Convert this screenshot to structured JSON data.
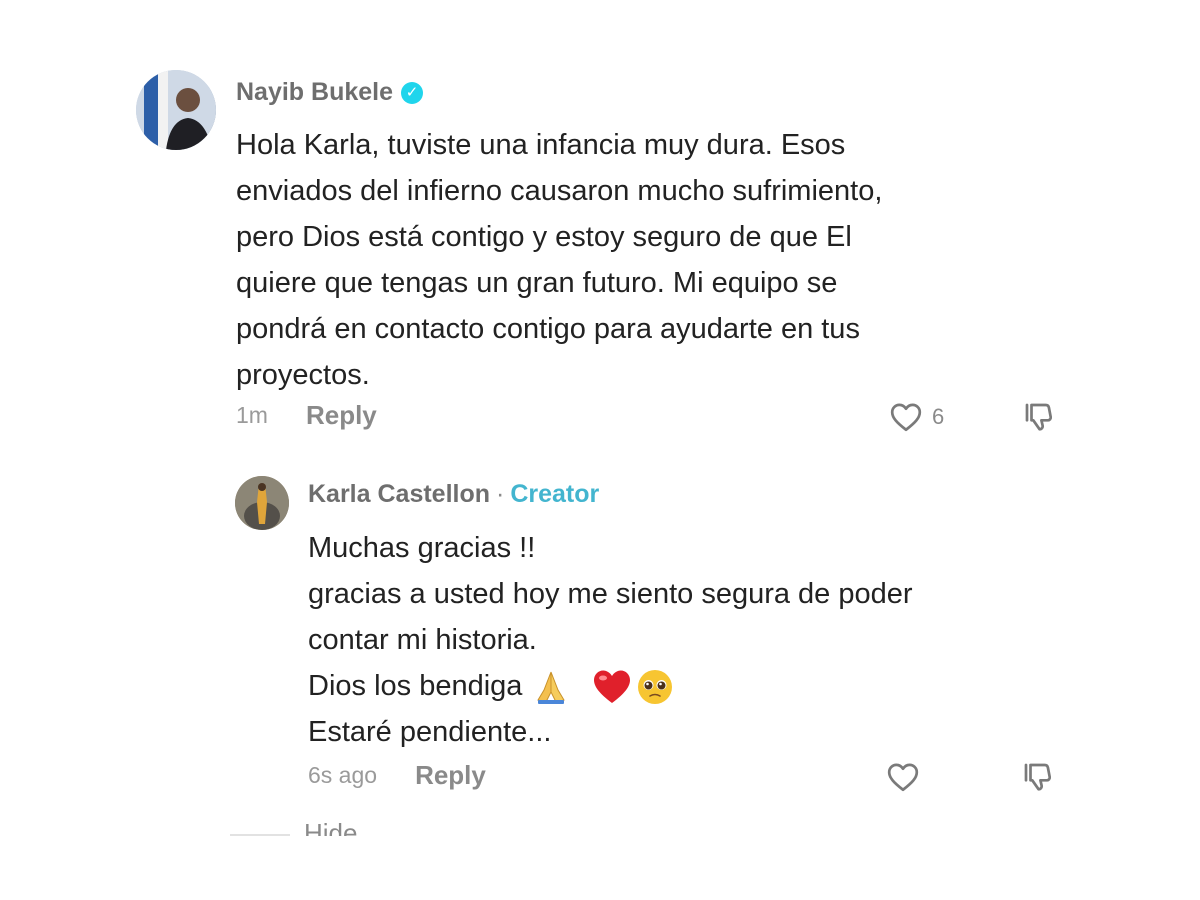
{
  "comments": [
    {
      "author": "Nayib Bukele",
      "verified": true,
      "lines": [
        "Hola Karla, tuviste una infancia muy dura. Esos",
        "enviados del infierno causaron mucho sufrimiento,",
        "pero Dios está contigo y estoy seguro de que El",
        "quiere que tengas un gran futuro. Mi equipo se",
        "pondrá en contacto contigo para ayudarte en tus",
        "proyectos."
      ],
      "timestamp": "1m",
      "reply_label": "Reply",
      "like_count": "6",
      "icons": [
        "avatar",
        "verified-icon",
        "heart-icon",
        "dislike-icon"
      ]
    },
    {
      "author": "Karla Castellon",
      "separator": "·",
      "badge": "Creator",
      "lines": [
        "Muchas gracias !!",
        "gracias a usted hoy me siento segura de poder",
        "contar mi historia.",
        "Dios los bendiga",
        "Estaré pendiente..."
      ],
      "emojis": [
        "folded-hands",
        "red-heart",
        "pleading-face"
      ],
      "timestamp": "6s ago",
      "reply_label": "Reply",
      "icons": [
        "avatar",
        "heart-icon",
        "dislike-icon"
      ]
    }
  ],
  "hide_label": "Hide",
  "colors": {
    "verified": "#20d5ec",
    "creator_badge": "#43b5cf",
    "meta_text": "#8a8a8a",
    "body_text": "#222222"
  }
}
